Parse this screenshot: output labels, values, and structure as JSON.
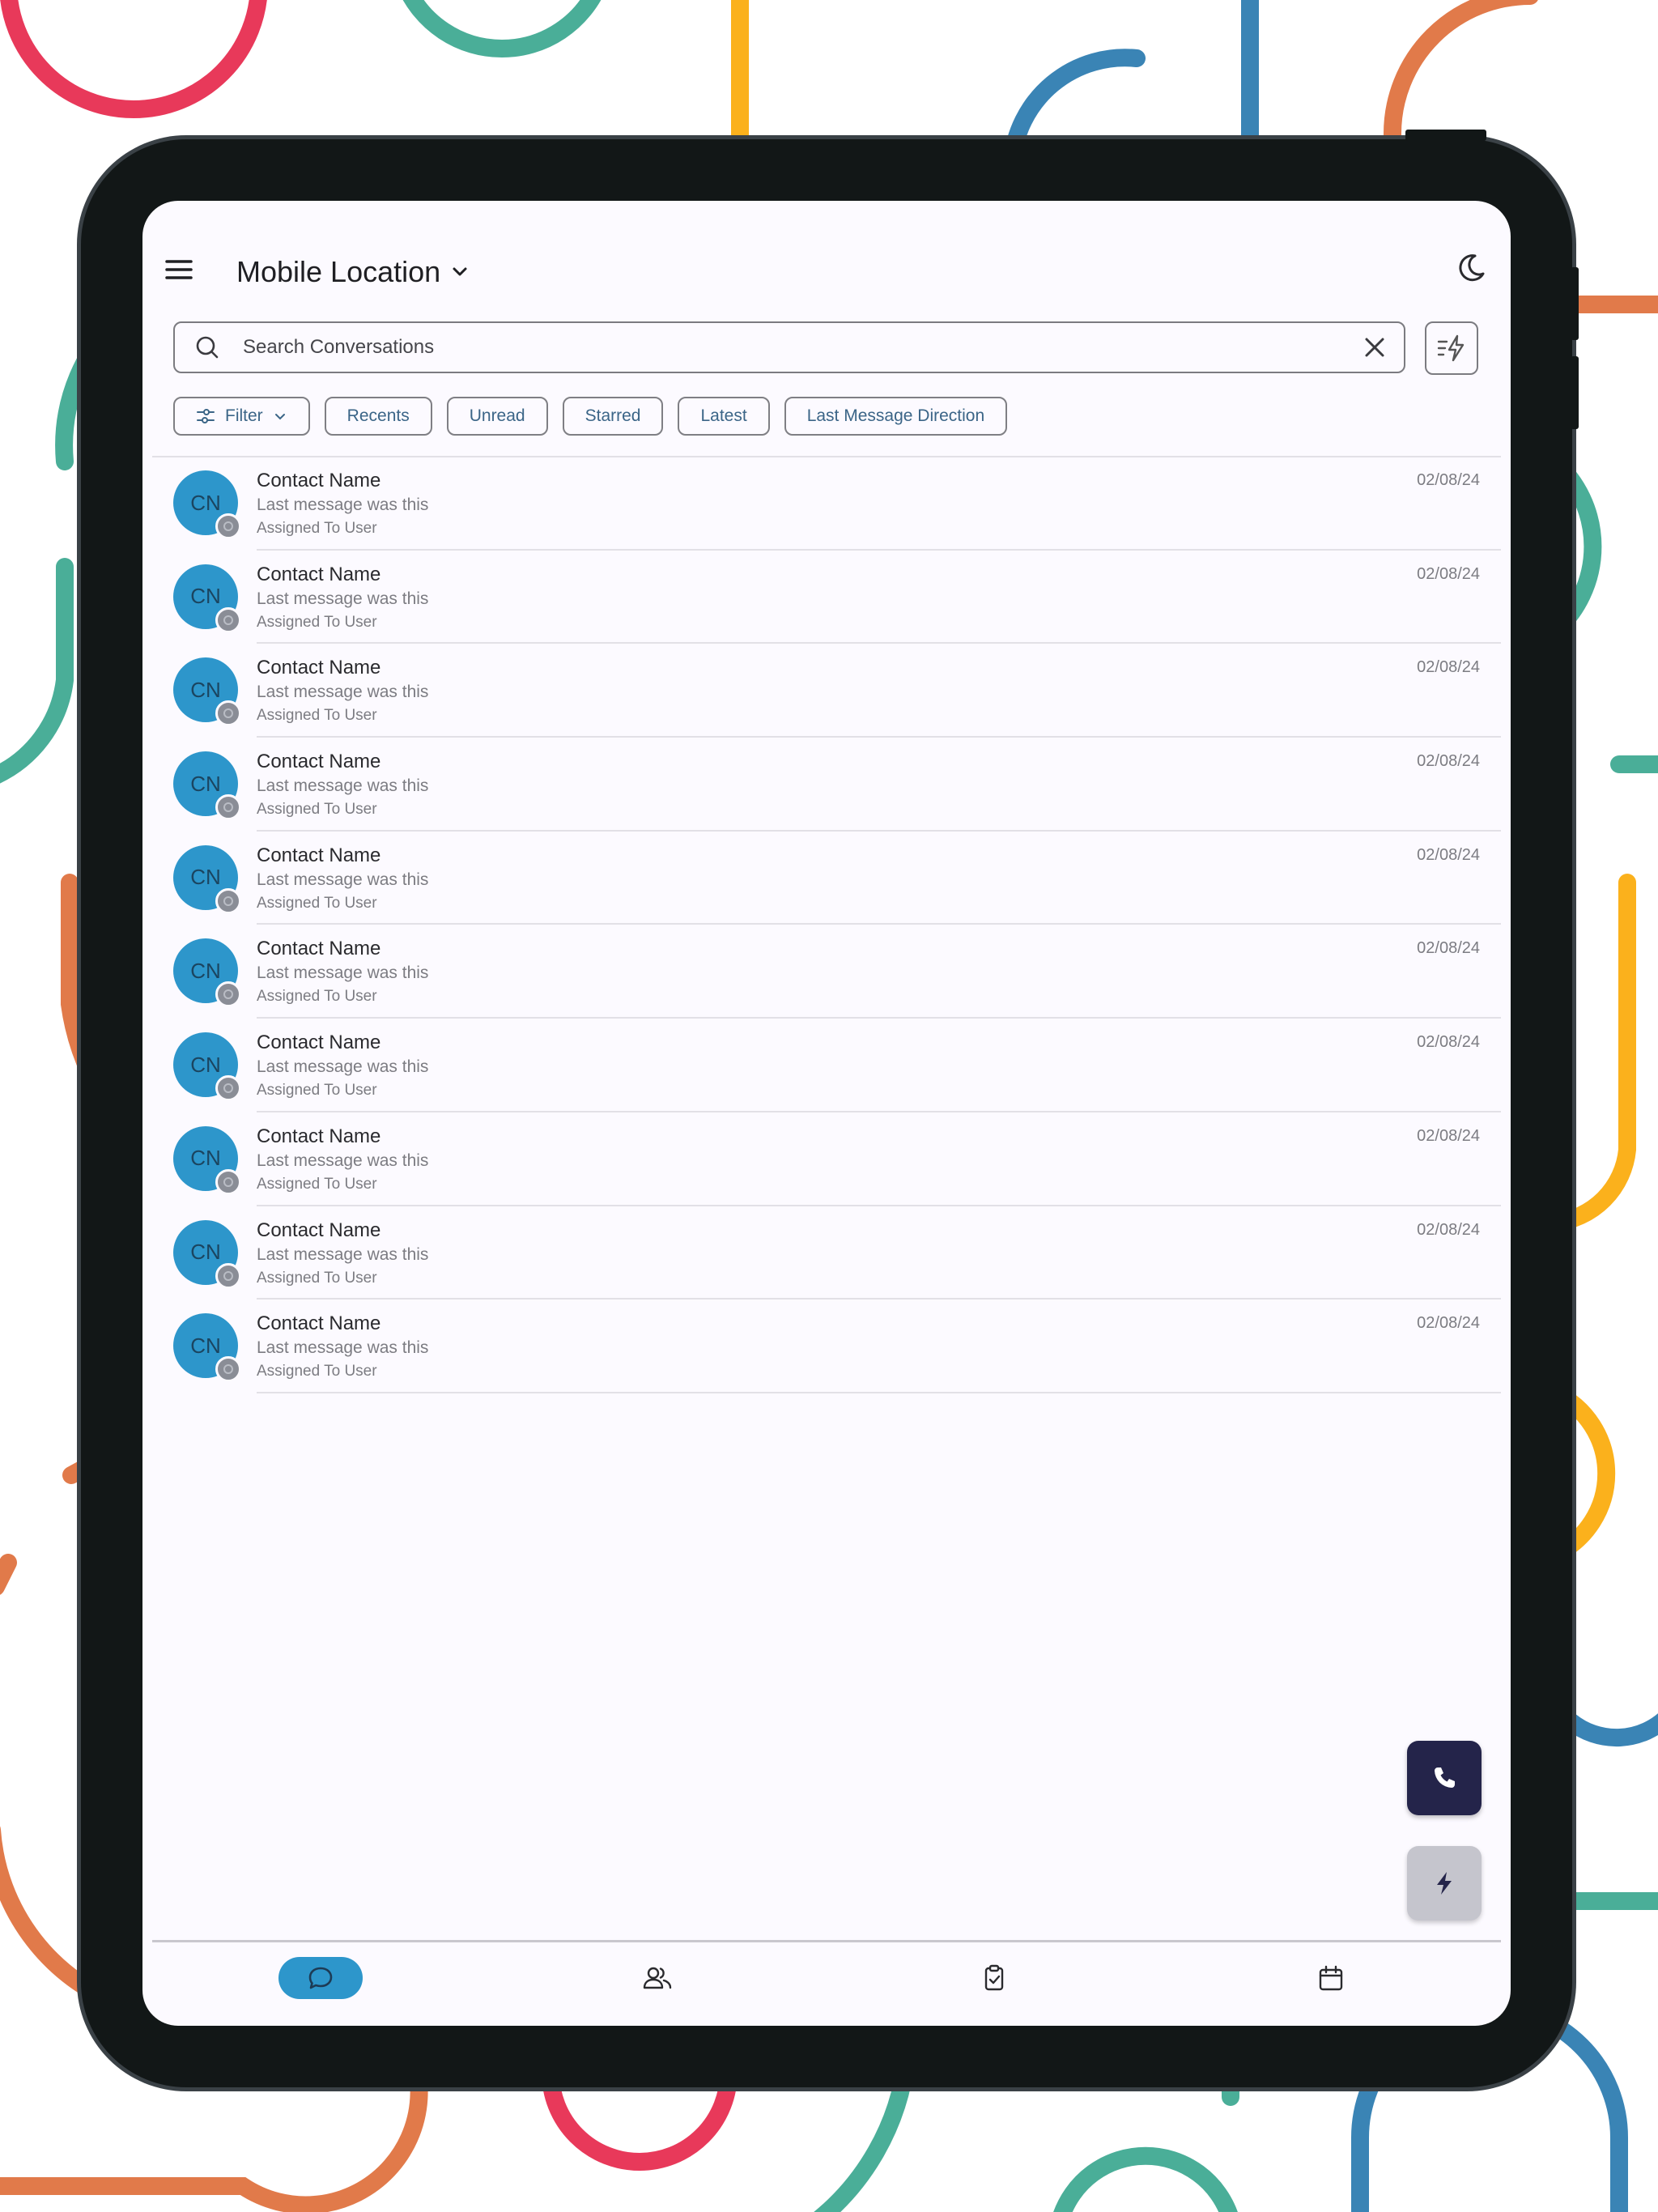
{
  "app": {
    "location_title": "Mobile Location"
  },
  "search": {
    "placeholder": "Search Conversations",
    "value": ""
  },
  "filters": {
    "chips": [
      "Filter",
      "Recents",
      "Unread",
      "Starred",
      "Latest",
      "Last Message Direction"
    ]
  },
  "conversations": [
    {
      "initials": "CN",
      "name": "Contact Name",
      "last_message": "Last message was this",
      "assigned": "Assigned To User",
      "date": "02/08/24"
    },
    {
      "initials": "CN",
      "name": "Contact Name",
      "last_message": "Last message was this",
      "assigned": "Assigned To User",
      "date": "02/08/24"
    },
    {
      "initials": "CN",
      "name": "Contact Name",
      "last_message": "Last message was this",
      "assigned": "Assigned To User",
      "date": "02/08/24"
    },
    {
      "initials": "CN",
      "name": "Contact Name",
      "last_message": "Last message was this",
      "assigned": "Assigned To User",
      "date": "02/08/24"
    },
    {
      "initials": "CN",
      "name": "Contact Name",
      "last_message": "Last message was this",
      "assigned": "Assigned To User",
      "date": "02/08/24"
    },
    {
      "initials": "CN",
      "name": "Contact Name",
      "last_message": "Last message was this",
      "assigned": "Assigned To User",
      "date": "02/08/24"
    },
    {
      "initials": "CN",
      "name": "Contact Name",
      "last_message": "Last message was this",
      "assigned": "Assigned To User",
      "date": "02/08/24"
    },
    {
      "initials": "CN",
      "name": "Contact Name",
      "last_message": "Last message was this",
      "assigned": "Assigned To User",
      "date": "02/08/24"
    },
    {
      "initials": "CN",
      "name": "Contact Name",
      "last_message": "Last message was this",
      "assigned": "Assigned To User",
      "date": "02/08/24"
    },
    {
      "initials": "CN",
      "name": "Contact Name",
      "last_message": "Last message was this",
      "assigned": "Assigned To User",
      "date": "02/08/24"
    }
  ],
  "icons": {
    "menu": "menu-icon",
    "dropdown": "chevron-down-icon",
    "theme": "moon-icon",
    "search": "search-icon",
    "clear": "close-icon",
    "quick_filter": "filter-lightning-icon",
    "filter_chip": "sliders-icon",
    "fab_call": "phone-icon",
    "fab_quick": "lightning-icon",
    "nav": [
      "chat-bubble-icon",
      "contacts-icon",
      "clipboard-check-icon",
      "calendar-icon"
    ]
  },
  "colors": {
    "accent": "#2d96cb",
    "avatar_text": "#1b4560",
    "chip_text": "#3b6587",
    "fab_call": "#24244a",
    "fab_quick": "#c5c5cd",
    "screen_bg": "#fcfaff",
    "bezel": "#121717"
  },
  "bottom_nav": {
    "active_index": 0
  }
}
